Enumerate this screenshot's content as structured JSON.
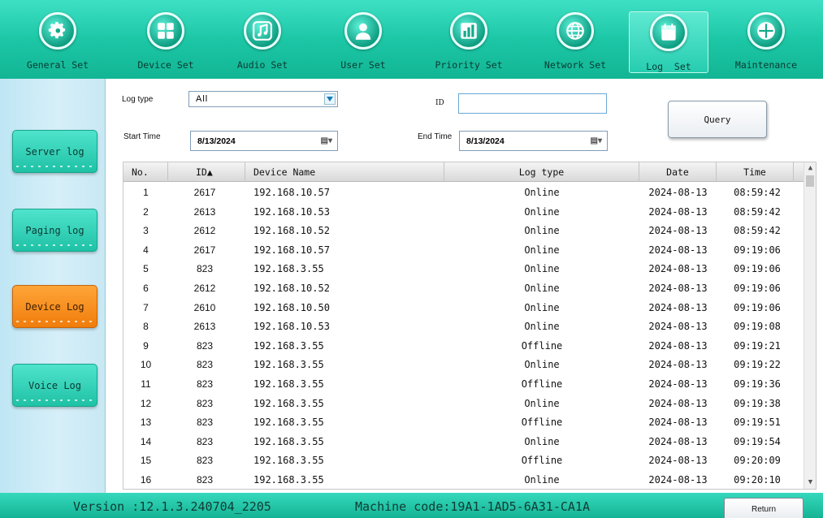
{
  "toolbar": {
    "tabs": [
      {
        "label": "General Set",
        "icon": "gear-icon"
      },
      {
        "label": "Device Set",
        "icon": "grid-icon"
      },
      {
        "label": "Audio Set",
        "icon": "music-note-icon"
      },
      {
        "label": "User Set",
        "icon": "user-icon"
      },
      {
        "label": "Priority Set",
        "icon": "bar-chart-icon"
      },
      {
        "label": "Network Set",
        "icon": "globe-icon"
      },
      {
        "label": "Log  Set",
        "icon": "calendar-icon"
      },
      {
        "label": "Maintenance",
        "icon": "wrench-icon"
      }
    ],
    "active_tab": "Log  Set"
  },
  "sidebar": {
    "items": [
      {
        "label": "Server log"
      },
      {
        "label": "Paging log"
      },
      {
        "label": "Device Log"
      },
      {
        "label": "Voice Log"
      }
    ],
    "active_item": "Device Log"
  },
  "filters": {
    "log_type_label": "Log type",
    "log_type_value": "All",
    "id_label": "ID",
    "id_value": "",
    "start_time_label": "Start Time",
    "start_time_value": "8/13/2024",
    "end_time_label": "End Time",
    "end_time_value": "8/13/2024",
    "query_label": "Query"
  },
  "table": {
    "columns": [
      "No.",
      "ID▲",
      "Device Name",
      "Log type",
      "Date",
      "Time"
    ],
    "rows": [
      [
        "1",
        "2617",
        "192.168.10.57",
        "Online",
        "2024-08-13",
        "08:59:42"
      ],
      [
        "2",
        "2613",
        "192.168.10.53",
        "Online",
        "2024-08-13",
        "08:59:42"
      ],
      [
        "3",
        "2612",
        "192.168.10.52",
        "Online",
        "2024-08-13",
        "08:59:42"
      ],
      [
        "4",
        "2617",
        "192.168.10.57",
        "Online",
        "2024-08-13",
        "09:19:06"
      ],
      [
        "5",
        "823",
        "192.168.3.55",
        "Online",
        "2024-08-13",
        "09:19:06"
      ],
      [
        "6",
        "2612",
        "192.168.10.52",
        "Online",
        "2024-08-13",
        "09:19:06"
      ],
      [
        "7",
        "2610",
        "192.168.10.50",
        "Online",
        "2024-08-13",
        "09:19:06"
      ],
      [
        "8",
        "2613",
        "192.168.10.53",
        "Online",
        "2024-08-13",
        "09:19:08"
      ],
      [
        "9",
        "823",
        "192.168.3.55",
        "Offline",
        "2024-08-13",
        "09:19:21"
      ],
      [
        "10",
        "823",
        "192.168.3.55",
        "Online",
        "2024-08-13",
        "09:19:22"
      ],
      [
        "11",
        "823",
        "192.168.3.55",
        "Offline",
        "2024-08-13",
        "09:19:36"
      ],
      [
        "12",
        "823",
        "192.168.3.55",
        "Online",
        "2024-08-13",
        "09:19:38"
      ],
      [
        "13",
        "823",
        "192.168.3.55",
        "Offline",
        "2024-08-13",
        "09:19:51"
      ],
      [
        "14",
        "823",
        "192.168.3.55",
        "Online",
        "2024-08-13",
        "09:19:54"
      ],
      [
        "15",
        "823",
        "192.168.3.55",
        "Offline",
        "2024-08-13",
        "09:20:09"
      ],
      [
        "16",
        "823",
        "192.168.3.55",
        "Online",
        "2024-08-13",
        "09:20:10"
      ]
    ]
  },
  "footer": {
    "version": "Version :12.1.3.240704_2205",
    "machine_code": "Machine code:19A1-1AD5-6A31-CA1A",
    "return_label": "Return"
  },
  "colors": {
    "teal_accent": "#1cc7a6",
    "active_orange": "#f07d0c",
    "sidebar_bg": "#d6eff8"
  }
}
